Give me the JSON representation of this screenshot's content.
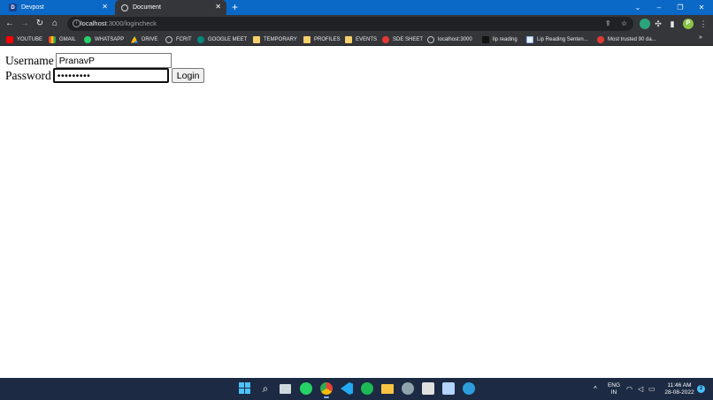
{
  "browser": {
    "tabs": [
      {
        "title": "Devpost",
        "favicon_letter": "D",
        "active": false
      },
      {
        "title": "Document",
        "active": true
      }
    ],
    "new_tab_symbol": "+",
    "window_controls": {
      "menu": "⌄",
      "minimize": "–",
      "restore": "❐",
      "close": "✕"
    },
    "url": {
      "host": "localhost",
      "rest": ":3000/logincheck"
    },
    "profile_letter": "P"
  },
  "bookmarks": [
    {
      "label": "YOUTUBE",
      "icon": "youtube-icon"
    },
    {
      "label": "GMAIL",
      "icon": "gmail-icon"
    },
    {
      "label": "WHATSAPP",
      "icon": "whatsapp-icon"
    },
    {
      "label": "DRIVE",
      "icon": "drive-icon"
    },
    {
      "label": "FCRIT",
      "icon": "globe-icon"
    },
    {
      "label": "GOOGLE MEET",
      "icon": "google-meet-icon"
    },
    {
      "label": "TEMPORARY",
      "icon": "folder-icon"
    },
    {
      "label": "PROFILES",
      "icon": "folder-icon"
    },
    {
      "label": "EVENTS",
      "icon": "folder-icon"
    },
    {
      "label": "SDE SHEET",
      "icon": "sde-sheet-icon"
    },
    {
      "label": "localhost:3000",
      "icon": "globe-icon"
    },
    {
      "label": "lip reading",
      "icon": "page-icon"
    },
    {
      "label": "Lip Reading Senten...",
      "icon": "lip-reading-icon"
    },
    {
      "label": "Most trusted 90 da...",
      "icon": "news-icon"
    }
  ],
  "form": {
    "username_label": "Username",
    "username_value": "PranavP",
    "password_label": "Password",
    "password_value": "•••••••••",
    "login_label": "Login"
  },
  "taskbar": {
    "apps": [
      "start-icon",
      "search-icon",
      "task-view-icon",
      "whatsapp-icon",
      "chrome-icon",
      "vscode-icon",
      "spotify-icon",
      "file-explorer-icon",
      "settings-icon",
      "store-icon",
      "photos-icon",
      "edge-icon"
    ],
    "lang_top": "ENG",
    "lang_bottom": "IN",
    "time": "11:46 AM",
    "date": "28-08-2022",
    "notification_count": "2"
  }
}
